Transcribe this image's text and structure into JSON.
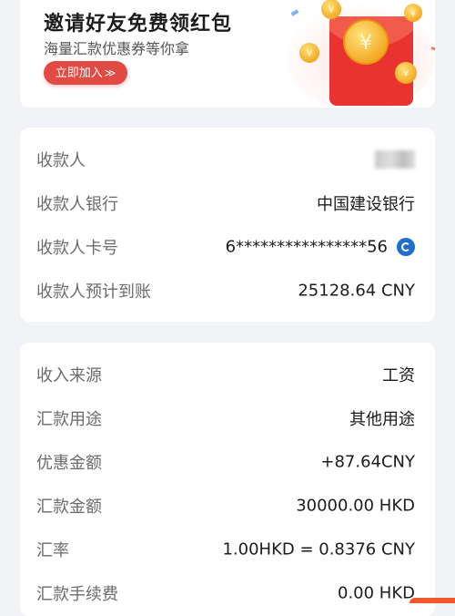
{
  "banner": {
    "title": "邀请好友免费领红包",
    "subtitle": "海量汇款优惠券等你拿",
    "cta_label": "立即加入",
    "cta_chevron": "≫"
  },
  "recipient": {
    "rows": [
      {
        "label": "收款人",
        "value": ""
      },
      {
        "label": "收款人银行",
        "value": "中国建设银行"
      },
      {
        "label": "收款人卡号",
        "value": "6****************56"
      },
      {
        "label": "收款人预计到账",
        "value": "25128.64 CNY"
      }
    ]
  },
  "details": {
    "rows": [
      {
        "label": "收入来源",
        "value": "工资"
      },
      {
        "label": "汇款用途",
        "value": "其他用途"
      },
      {
        "label": "优惠金额",
        "value": "+87.64CNY"
      },
      {
        "label": "汇款金额",
        "value": "30000.00 HKD"
      },
      {
        "label": "汇率",
        "value": "1.00HKD = 0.8376 CNY"
      },
      {
        "label": "汇款手续费",
        "value": "0.00 HKD"
      }
    ]
  },
  "colors": {
    "accent": "#e24b43",
    "bank_icon": "#1f6fd0"
  },
  "icons": {
    "bank": "ccb-bank-icon",
    "banner_art": "red-envelope-coins-icon"
  }
}
